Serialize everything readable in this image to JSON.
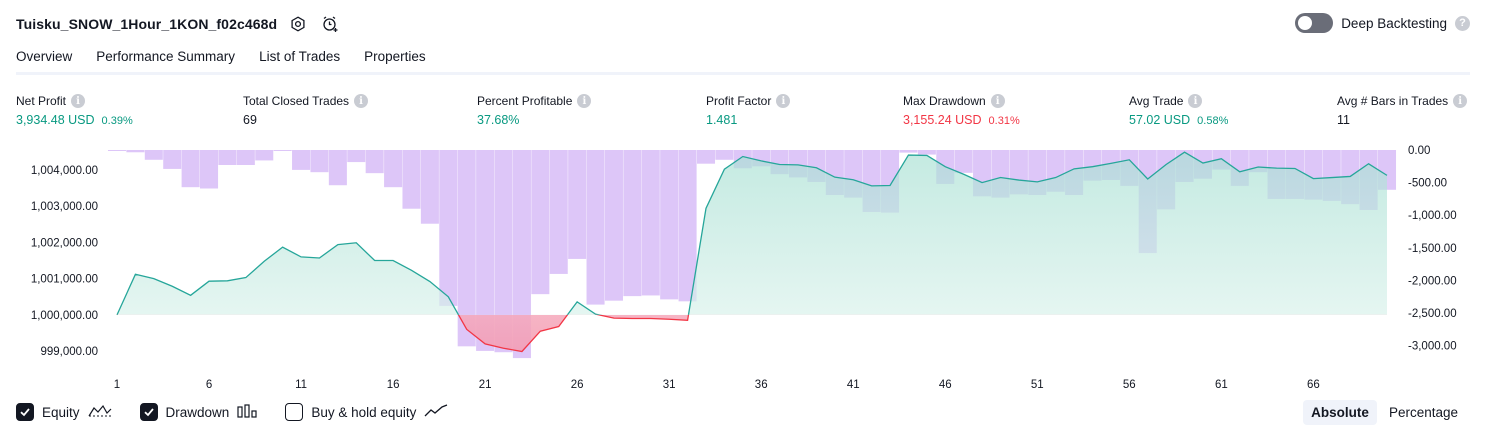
{
  "header": {
    "strategy_name": "Tuisku_SNOW_1Hour_1KON_f02c468d",
    "settings_icon": "gear-icon",
    "alert_icon": "alarm-add-icon",
    "deep_backtesting_label": "Deep Backtesting",
    "deep_backtesting_on": false,
    "help_icon": "help-icon"
  },
  "tabs": [
    {
      "label": "Overview",
      "active": true
    },
    {
      "label": "Performance Summary",
      "active": false
    },
    {
      "label": "List of Trades",
      "active": false
    },
    {
      "label": "Properties",
      "active": false
    }
  ],
  "metrics": [
    {
      "label": "Net Profit",
      "value": "3,934.48 USD",
      "pct": "0.39%",
      "tone": "green"
    },
    {
      "label": "Total Closed Trades",
      "value": "69",
      "pct": "",
      "tone": "plain"
    },
    {
      "label": "Percent Profitable",
      "value": "37.68%",
      "pct": "",
      "tone": "green"
    },
    {
      "label": "Profit Factor",
      "value": "1.481",
      "pct": "",
      "tone": "green"
    },
    {
      "label": "Max Drawdown",
      "value": "3,155.24 USD",
      "pct": "0.31%",
      "tone": "red"
    },
    {
      "label": "Avg Trade",
      "value": "57.02 USD",
      "pct": "0.58%",
      "tone": "green"
    },
    {
      "label": "Avg # Bars in Trades",
      "value": "11",
      "pct": "",
      "tone": "plain"
    }
  ],
  "chart_data": {
    "type": "area",
    "baseline": 1000000,
    "x_ticks": [
      "1",
      "6",
      "11",
      "16",
      "21",
      "26",
      "31",
      "36",
      "41",
      "46",
      "51",
      "56",
      "61",
      "66"
    ],
    "left_axis": {
      "ticks": [
        "999,000.00",
        "1,000,000.00",
        "1,001,000.00",
        "1,002,000.00",
        "1,003,000.00",
        "1,004,000.00"
      ],
      "range": [
        998700,
        1004550
      ]
    },
    "right_axis": {
      "ticks": [
        "0.00",
        "-500.00",
        "-1,000.00",
        "-1,500.00",
        "-2,000.00",
        "-2,500.00",
        "-3,000.00"
      ],
      "range": [
        -3250,
        0
      ]
    },
    "series": [
      {
        "name": "Equity",
        "color_positive": "#26a69a",
        "color_negative": "#f23645",
        "values": [
          1000000,
          1001120,
          1001000,
          1000790,
          1000540,
          1000930,
          1000940,
          1001030,
          1001480,
          1001870,
          1001600,
          1001570,
          1001940,
          1001990,
          1001500,
          1001500,
          1001230,
          1000920,
          1000500,
          999600,
          999200,
          999080,
          998990,
          999550,
          999680,
          1000360,
          1000020,
          999910,
          999900,
          999900,
          999880,
          999850,
          1002940,
          1004020,
          1004370,
          1004250,
          1004150,
          1004140,
          1004060,
          1003800,
          1003730,
          1003560,
          1003570,
          1004410,
          1004400,
          1004090,
          1003880,
          1003650,
          1003790,
          1003720,
          1003670,
          1003790,
          1004030,
          1004090,
          1004180,
          1004280,
          1003750,
          1004150,
          1004490,
          1004190,
          1004310,
          1003950,
          1004080,
          1004050,
          1004040,
          1003760,
          1003790,
          1003820,
          1004170,
          1003850
        ]
      },
      {
        "name": "Drawdown",
        "color": "#d1b3f5",
        "values": [
          0,
          -35,
          -150,
          -290,
          -570,
          -590,
          -230,
          -230,
          -160,
          0,
          -305,
          -340,
          -540,
          -185,
          -355,
          -570,
          -900,
          -1130,
          -2390,
          -3010,
          -3080,
          -3100,
          -3190,
          -2210,
          -1900,
          -1670,
          -2370,
          -2310,
          -2240,
          -2230,
          -2290,
          -2320,
          -210,
          -150,
          -280,
          -250,
          -370,
          -420,
          -490,
          -690,
          -730,
          -950,
          -960,
          -40,
          -70,
          -520,
          -350,
          -710,
          -730,
          -680,
          -690,
          -640,
          -690,
          -470,
          -460,
          -550,
          -1580,
          -910,
          -490,
          -440,
          -300,
          -550,
          -340,
          -750,
          -750,
          -760,
          -780,
          -830,
          -920,
          -610
        ]
      }
    ]
  },
  "legend": [
    {
      "label": "Equity",
      "checked": true,
      "icon": "equity-line-icon"
    },
    {
      "label": "Drawdown",
      "checked": true,
      "icon": "drawdown-bars-icon"
    },
    {
      "label": "Buy & hold equity",
      "checked": false,
      "icon": "buy-hold-line-icon"
    }
  ],
  "modes": [
    {
      "label": "Absolute",
      "active": true
    },
    {
      "label": "Percentage",
      "active": false
    }
  ]
}
